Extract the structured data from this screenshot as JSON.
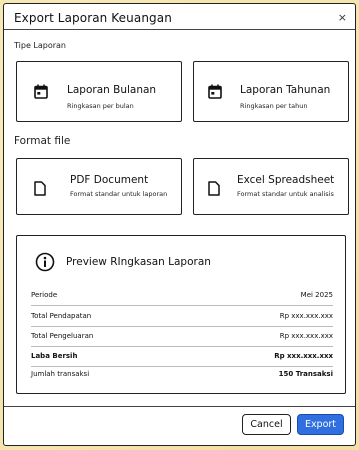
{
  "dialog": {
    "title": "Export Laporan Keuangan",
    "close_glyph": "×"
  },
  "report_type": {
    "label": "Tipe Laporan",
    "options": [
      {
        "title": "Laporan Bulanan",
        "subtitle": "Ringkasan per bulan",
        "icon": "calendar-icon"
      },
      {
        "title": "Laporan Tahunan",
        "subtitle": "Ringkasan per tahun",
        "icon": "calendar-icon"
      }
    ]
  },
  "file_format": {
    "label": "Format file",
    "options": [
      {
        "title": "PDF Document",
        "subtitle": "Format standar untuk laporan",
        "icon": "document-icon"
      },
      {
        "title": "Excel Spreadsheet",
        "subtitle": "Format standar untuk analisis",
        "icon": "document-icon"
      }
    ]
  },
  "preview": {
    "title": "Preview RIngkasan Laporan",
    "icon": "info-icon",
    "rows": [
      {
        "label": "Periode",
        "value": "Mei 2025"
      },
      {
        "label": "Total Pendapatan",
        "value": "Rp xxx.xxx.xxx"
      },
      {
        "label": "Total Pengeluaran",
        "value": "Rp xxx.xxx.xxx"
      },
      {
        "label": "Laba Bersih",
        "value": "Rp xxx.xxx.xxx"
      },
      {
        "label": "Jumlah transaksi",
        "value": "150 Transaksi"
      }
    ]
  },
  "footer": {
    "cancel_label": "Cancel",
    "export_label": "Export"
  },
  "colors": {
    "background": "#f4e4ad",
    "primary_button": "#2f6fe0",
    "border": "#222222"
  }
}
